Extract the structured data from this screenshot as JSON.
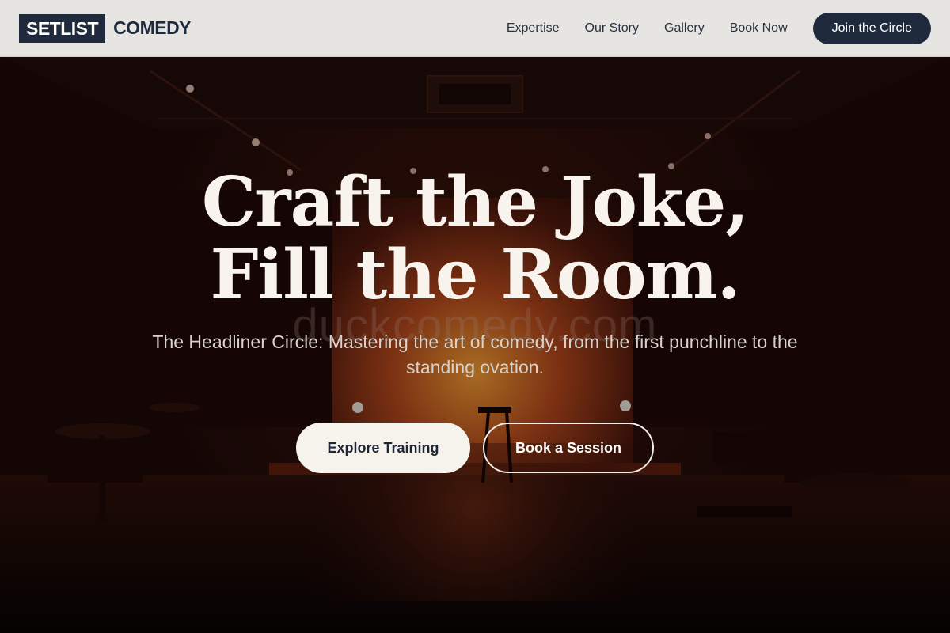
{
  "brand": {
    "logo_box": "SETLIST",
    "logo_text": "COMEDY"
  },
  "nav": {
    "items": [
      {
        "label": "Expertise"
      },
      {
        "label": "Our Story"
      },
      {
        "label": "Gallery"
      },
      {
        "label": "Book Now"
      }
    ],
    "cta": "Join the Circle"
  },
  "hero": {
    "headline_line1": "Craft the Joke,",
    "headline_line2": "Fill the Room.",
    "subtitle": "The Headliner Circle: Mastering the art of comedy, from the first punchline to the standing ovation.",
    "primary_button": "Explore Training",
    "secondary_button": "Book a Session",
    "watermark": "duckcomedy.com"
  },
  "colors": {
    "navy": "#1f2a3d",
    "header_bg": "#e6e5e2",
    "cream": "#f6f2ec",
    "stage_glow": "#e0882a"
  }
}
